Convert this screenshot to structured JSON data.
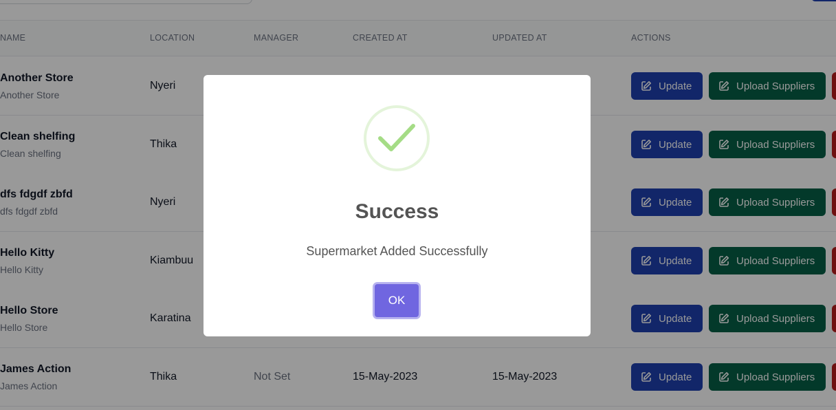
{
  "table": {
    "headers": {
      "name": "NAME",
      "location": "LOCATION",
      "manager": "MANAGER",
      "created_at": "CREATED AT",
      "updated_at": "UPDATED AT",
      "actions": "ACTIONS"
    },
    "rows": [
      {
        "name": "Another Store",
        "sub": "Another Store",
        "location": "Nyeri",
        "manager": "",
        "created_at": "",
        "updated_at": ""
      },
      {
        "name": "Clean shelfing",
        "sub": "Clean shelfing",
        "location": "Thika",
        "manager": "",
        "created_at": "",
        "updated_at": ""
      },
      {
        "name": "dfs fdgdf zbfd",
        "sub": "dfs fdgdf zbfd",
        "location": "Nyeri",
        "manager": "",
        "created_at": "",
        "updated_at": ""
      },
      {
        "name": "Hello Kitty",
        "sub": "Hello Kitty",
        "location": "Kiambuu",
        "manager": "",
        "created_at": "",
        "updated_at": ""
      },
      {
        "name": "Hello Store",
        "sub": "Hello Store",
        "location": "Karatina",
        "manager": "",
        "created_at": "",
        "updated_at": ""
      },
      {
        "name": "James Action",
        "sub": "James Action",
        "location": "Thika",
        "manager": "Not Set",
        "created_at": "15-May-2023",
        "updated_at": "15-May-2023"
      }
    ],
    "actions": {
      "update_label": "Update",
      "upload_label": "Upload Suppliers"
    }
  },
  "modal": {
    "title": "Success",
    "text": "Supermarket Added Successfully",
    "ok_label": "OK",
    "icon": "success-check-icon"
  },
  "colors": {
    "update_button": "#1e40af",
    "upload_button": "#065f46",
    "delete_button": "#b91c1c",
    "ok_button": "#7066e0",
    "success_check": "#a5dc86"
  }
}
